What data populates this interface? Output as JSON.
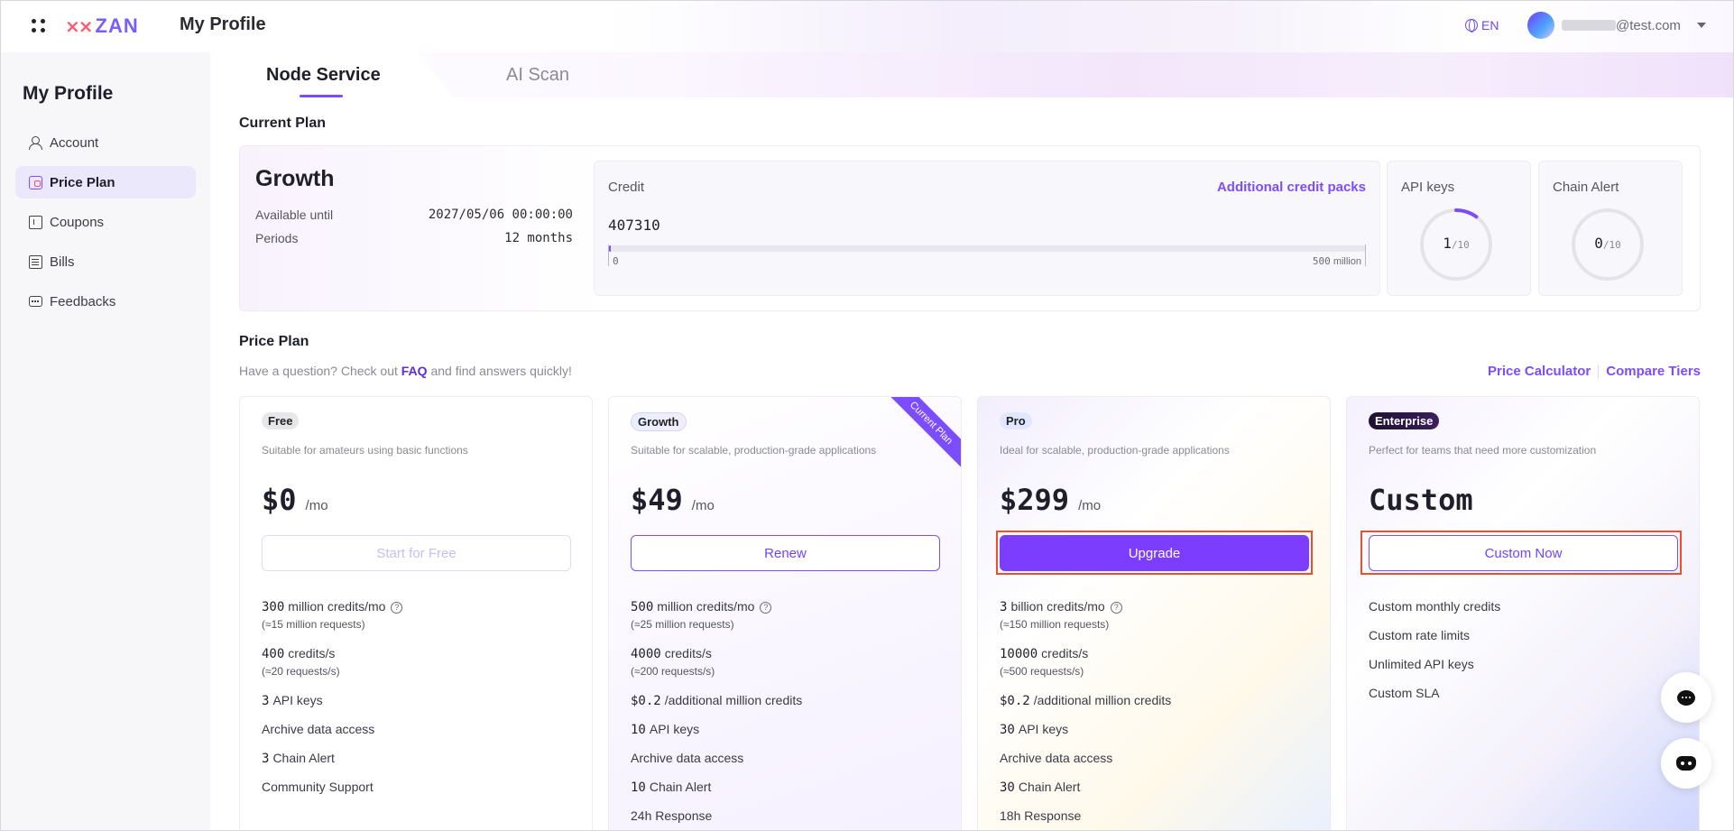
{
  "header": {
    "app_title": "My Profile",
    "logo_text": "ZAN",
    "language": "EN",
    "email_suffix": "@test.com"
  },
  "sidebar": {
    "title": "My Profile",
    "items": [
      {
        "label": "Account",
        "icon": "user-icon"
      },
      {
        "label": "Price Plan",
        "icon": "price-plan-icon",
        "active": true
      },
      {
        "label": "Coupons",
        "icon": "coupon-icon"
      },
      {
        "label": "Bills",
        "icon": "bill-icon"
      },
      {
        "label": "Feedbacks",
        "icon": "feedback-icon"
      }
    ]
  },
  "tabs": [
    {
      "label": "Node Service",
      "active": true
    },
    {
      "label": "AI Scan",
      "active": false
    }
  ],
  "current_plan": {
    "section_title": "Current Plan",
    "name": "Growth",
    "available_until_label": "Available until",
    "available_until_value": "2027/05/06 00:00:00",
    "periods_label": "Periods",
    "periods_value": "12 months",
    "credit": {
      "label": "Credit",
      "link": "Additional credit packs",
      "value": "407310",
      "min": "0",
      "max_num": "500",
      "max_unit": "million",
      "used_fraction": 0.0008
    },
    "api_keys": {
      "label": "API keys",
      "used": "1",
      "total": "/10",
      "fraction": 0.1
    },
    "chain_alert": {
      "label": "Chain Alert",
      "used": "0",
      "total": "/10",
      "fraction": 0.0
    }
  },
  "price_plan": {
    "section_title": "Price Plan",
    "subtitle_pre": "Have a question? Check out ",
    "subtitle_link": "FAQ",
    "subtitle_post": " and find answers quickly!",
    "link_calculator": "Price Calculator",
    "link_compare": "Compare Tiers",
    "current_ribbon": "Current Plan",
    "plans": {
      "free": {
        "badge": "Free",
        "desc": "Suitable for amateurs using basic functions",
        "price": "$0",
        "per": "/mo",
        "button": "Start for Free",
        "f1_num": "300",
        "f1_text": "million credits/mo",
        "f1_note": "(≈15 million requests)",
        "f2_num": "400",
        "f2_text": "credits/s",
        "f2_note": "(≈20 requests/s)",
        "f3_num": "3",
        "f3_text": "API keys",
        "f4_text": "Archive data access",
        "f5_num": "3",
        "f5_text": "Chain Alert",
        "f6_text": "Community Support"
      },
      "growth": {
        "badge": "Growth",
        "desc": "Suitable for scalable, production-grade applications",
        "price": "$49",
        "per": "/mo",
        "button": "Renew",
        "f1_num": "500",
        "f1_text": "million credits/mo",
        "f1_note": "(≈25 million requests)",
        "f2_num": "4000",
        "f2_text": "credits/s",
        "f2_note": "(≈200 requests/s)",
        "f3_num": "$0.2",
        "f3_text": "/additional million credits",
        "f4_num": "10",
        "f4_text": "API keys",
        "f5_text": "Archive data access",
        "f6_num": "10",
        "f6_text": "Chain Alert",
        "f7_text": "24h Response"
      },
      "pro": {
        "badge": "Pro",
        "desc": "Ideal for scalable, production-grade applications",
        "price": "$299",
        "per": "/mo",
        "button": "Upgrade",
        "f1_num": "3",
        "f1_text": "billion credits/mo",
        "f1_note": "(≈150 million requests)",
        "f2_num": "10000",
        "f2_text": "credits/s",
        "f2_note": "(≈500 requests/s)",
        "f3_num": "$0.2",
        "f3_text": "/additional million credits",
        "f4_num": "30",
        "f4_text": "API keys",
        "f5_text": "Archive data access",
        "f6_num": "30",
        "f6_text": "Chain Alert",
        "f7_text": "18h Response"
      },
      "enterprise": {
        "badge": "Enterprise",
        "desc": "Perfect for teams that need more customization",
        "price": "Custom",
        "button": "Custom Now",
        "f1_text": "Custom monthly credits",
        "f2_text": "Custom rate limits",
        "f3_text": "Unlimited API keys",
        "f4_text": "Custom SLA"
      }
    }
  },
  "colors": {
    "accent": "#7c4dff",
    "highlight": "#e8512c"
  }
}
